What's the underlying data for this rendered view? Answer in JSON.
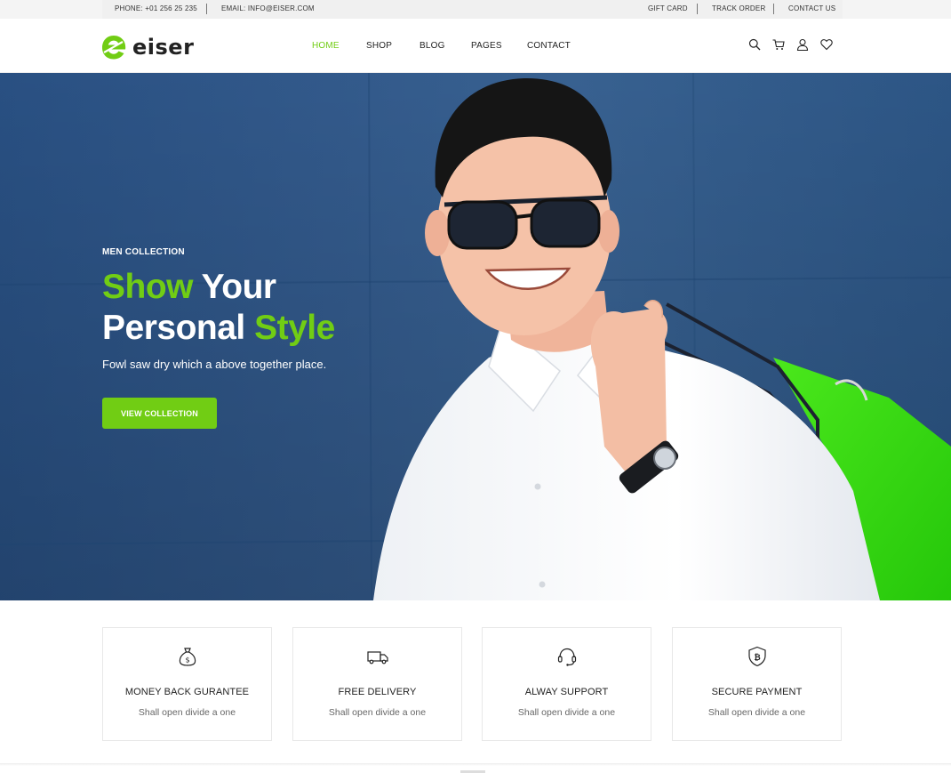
{
  "topbar": {
    "phone": "PHONE: +01 256 25 235",
    "email": "EMAIL: INFO@EISER.COM",
    "links": [
      "GIFT CARD",
      "TRACK ORDER",
      "CONTACT US"
    ]
  },
  "header": {
    "logo_text": "eiser",
    "nav": [
      "HOME",
      "SHOP",
      "BLOG",
      "PAGES",
      "CONTACT"
    ],
    "active_nav": "HOME",
    "icons": [
      "search-icon",
      "cart-icon",
      "user-icon",
      "heart-icon"
    ]
  },
  "hero": {
    "kicker": "MEN COLLECTION",
    "title_line1_accent": "Show",
    "title_line1_rest": " Your",
    "title_line2_main": "Personal ",
    "title_line2_accent": "Style",
    "subtitle": "Fowl saw dry which a above together place.",
    "button_label": "VIEW COLLECTION"
  },
  "features": [
    {
      "icon": "money-bag-icon",
      "title": "MONEY BACK GURANTEE",
      "desc": "Shall open divide a one"
    },
    {
      "icon": "truck-icon",
      "title": "FREE DELIVERY",
      "desc": "Shall open divide a one"
    },
    {
      "icon": "headset-icon",
      "title": "ALWAY SUPPORT",
      "desc": "Shall open divide a one"
    },
    {
      "icon": "shield-icon",
      "title": "SECURE PAYMENT",
      "desc": "Shall open divide a one"
    }
  ],
  "colors": {
    "accent": "#71cd14",
    "hero_bg": "#355e92",
    "text": "#222222"
  }
}
